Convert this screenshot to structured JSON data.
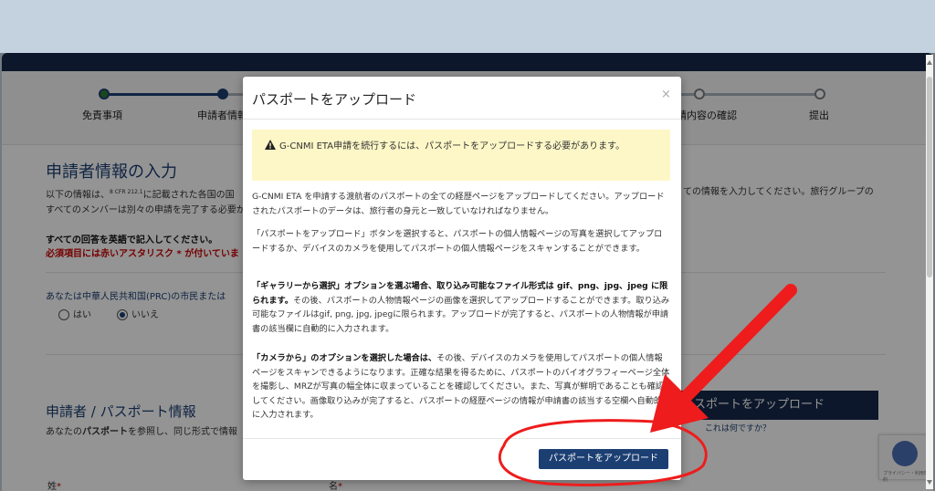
{
  "steps": [
    {
      "label": "免責事項"
    },
    {
      "label": "申請者情報"
    },
    {
      "label": "申請内容の確認"
    },
    {
      "label": "提出"
    }
  ],
  "page": {
    "title": "申請者情報の入力",
    "intro_l1": "以下の情報は、",
    "cfr": "8 CFR 212.1",
    "intro_l1b": "に記載された各国の国",
    "intro_l2": "すべてのメンバーは別々の申請を完了する必要があり",
    "intro_r1": "ての情報を入力してください。旅行グループの",
    "req_line1": "すべての回答を英語で記入してください。",
    "req_line2": "必須項目には赤いアスタリスク * が付いていま",
    "prc_question": "あなたは中華人民共和国(PRC)の市民または",
    "radio_yes": "はい",
    "radio_no": "いいえ",
    "section2_title": "申請者 / パスポート情報",
    "section2_desc_a": "あなたの",
    "section2_desc_b": "パスポート",
    "section2_desc_c": "を参照し、同じ形式で情報",
    "bg_upload_button": "スポートをアップロード",
    "what_is_this": "これは何ですか？",
    "field_surname": "姓",
    "field_given": "名",
    "asterisk": "*"
  },
  "recaptcha": {
    "text": "プライバシー・利用規約"
  },
  "modal": {
    "title": "パスポートをアップロード",
    "close": "×",
    "warning": "G-CNMI ETA申請を続行するには、パスポートをアップロードする必要があります。",
    "p1": "G-CNMI ETA を申請する渡航者のパスポートの全ての経歴ページをアップロードしてください。アップロードされたパスポートのデータは、旅行者の身元と一致していなければなりません。",
    "p2": "「パスポートをアップロード」ボタンを選択すると、パスポートの個人情報ページの写真を選択してアップロードするか、デバイスのカメラを使用してパスポートの個人情報ページをスキャンすることができます。",
    "p3_bold": "「ギャラリーから選択」オプションを選ぶ場合、取り込み可能なファイル形式は gif、png、jpg、jpeg に限られます。",
    "p3_rest": "その後、パスポートの人物情報ページの画像を選択してアップロードすることができます。取り込み可能なファイルはgif, png, jpg, jpegに限られます。アップロードが完了すると、パスポートの人物情報が申請書の該当欄に自動的に入力されます。",
    "p4_bold": "「カメラから」のオプションを選択した場合は、",
    "p4_rest": "その後、デバイスのカメラを使用してパスポートの個人情報ページをスキャンできるようになります。正確な結果を得るために、パスポートのバイオグラフィーページ全体を撮影し、MRZが写真の幅全体に収まっていることを確認してください。また、写真が鮮明であることも確認してください。画像取り込みが完了すると、パスポートの経歴ページの情報が申請書の該当する空欄へ自動的に入力されます。",
    "upload_button": "パスポートをアップロード"
  },
  "annotation": {
    "color": "#ee1c1c"
  }
}
